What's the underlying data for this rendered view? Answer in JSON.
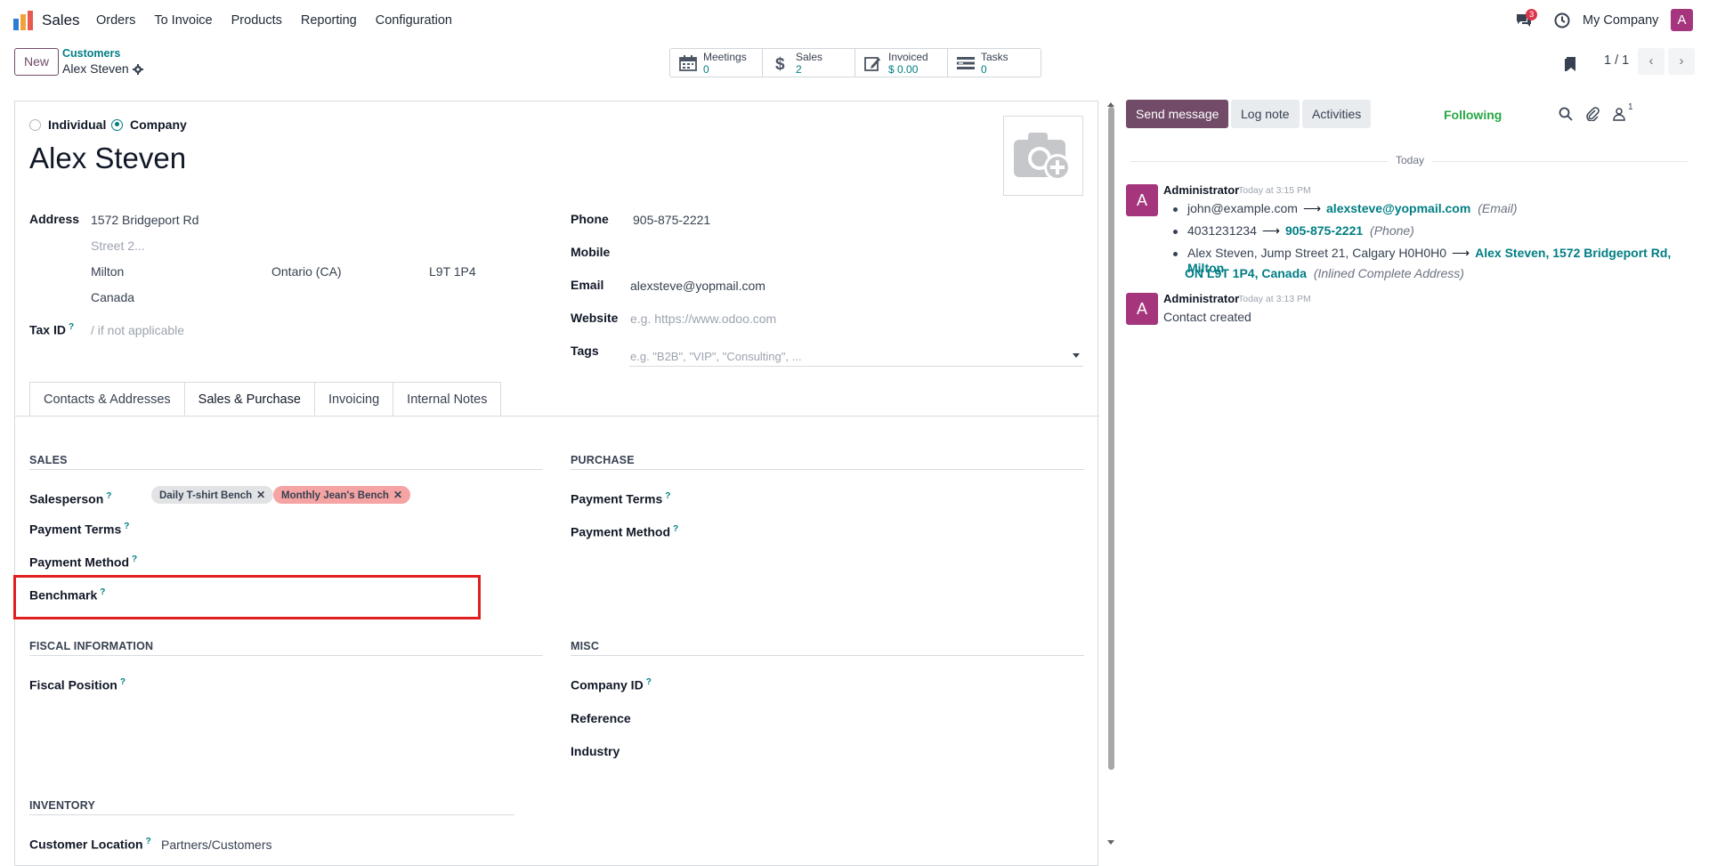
{
  "topbar": {
    "app_name": "Sales",
    "menu": [
      "Orders",
      "To Invoice",
      "Products",
      "Reporting",
      "Configuration"
    ],
    "message_count": "3",
    "company": "My Company",
    "user_initial": "A"
  },
  "control": {
    "new_label": "New",
    "breadcrumb_parent": "Customers",
    "breadcrumb_current": "Alex Steven",
    "stats": [
      {
        "label": "Meetings",
        "value": "0",
        "icon": "calendar-icon"
      },
      {
        "label": "Sales",
        "value": "2",
        "icon": "dollar-icon"
      },
      {
        "label": "Invoiced",
        "value": "$ 0.00",
        "icon": "invoice-icon"
      },
      {
        "label": "Tasks",
        "value": "0",
        "icon": "tasks-icon"
      }
    ],
    "pager": "1 / 1"
  },
  "form": {
    "type_individual": "Individual",
    "type_company": "Company",
    "name": "Alex Steven",
    "address_label": "Address",
    "street": "1572 Bridgeport Rd",
    "street2_placeholder": "Street 2...",
    "city": "Milton",
    "state": "Ontario (CA)",
    "zip": "L9T 1P4",
    "country": "Canada",
    "tax_id_label": "Tax ID",
    "tax_id_placeholder": "/ if not applicable",
    "phone_label": "Phone",
    "phone": "905-875-2221",
    "mobile_label": "Mobile",
    "email_label": "Email",
    "email": "alexsteve@yopmail.com",
    "website_label": "Website",
    "website_placeholder": "e.g. https://www.odoo.com",
    "tags_label": "Tags",
    "tags_placeholder": "e.g. \"B2B\", \"VIP\", \"Consulting\", ..."
  },
  "tabs": [
    "Contacts & Addresses",
    "Sales & Purchase",
    "Invoicing",
    "Internal Notes"
  ],
  "sales_purchase": {
    "sales_title": "SALES",
    "salesperson_label": "Salesperson",
    "payment_terms_label": "Payment Terms",
    "payment_method_label": "Payment Method",
    "benchmark_label": "Benchmark",
    "benchmark_tags": [
      {
        "label": "Daily T-shirt Bench",
        "color": "#e2e3e5"
      },
      {
        "label": "Monthly Jean's Bench",
        "color": "#f5a3a3"
      }
    ],
    "purchase_title": "PURCHASE",
    "p_payment_terms_label": "Payment Terms",
    "p_payment_method_label": "Payment Method",
    "fiscal_title": "FISCAL INFORMATION",
    "fiscal_position_label": "Fiscal Position",
    "misc_title": "MISC",
    "company_id_label": "Company ID",
    "reference_label": "Reference",
    "industry_label": "Industry",
    "inventory_title": "INVENTORY",
    "customer_location_label": "Customer Location",
    "customer_location": "Partners/Customers"
  },
  "chatter": {
    "send_message": "Send message",
    "log_note": "Log note",
    "activities": "Activities",
    "followers_count": "1",
    "following": "Following",
    "today": "Today",
    "messages": [
      {
        "author": "Administrator",
        "time": "Today at 3:15 PM",
        "avatar": "A",
        "changes": [
          {
            "old": "john@example.com",
            "new": "alexsteve@yopmail.com",
            "field": "(Email)"
          },
          {
            "old": "4031231234",
            "new": "905-875-2221",
            "field": "(Phone)"
          },
          {
            "old": "Alex Steven, Jump Street 21, Calgary H0H0H0",
            "new_line1": "Alex Steven, 1572 Bridgeport Rd, Milton",
            "new_line2": "ON L9T 1P4, Canada",
            "field": "(Inlined Complete Address)"
          }
        ]
      },
      {
        "author": "Administrator",
        "time": "Today at 3:13 PM",
        "avatar": "A",
        "body": "Contact created"
      }
    ]
  },
  "colors": {
    "brand": "#714b67",
    "accent": "#017e84",
    "highlight": "#e02020"
  }
}
